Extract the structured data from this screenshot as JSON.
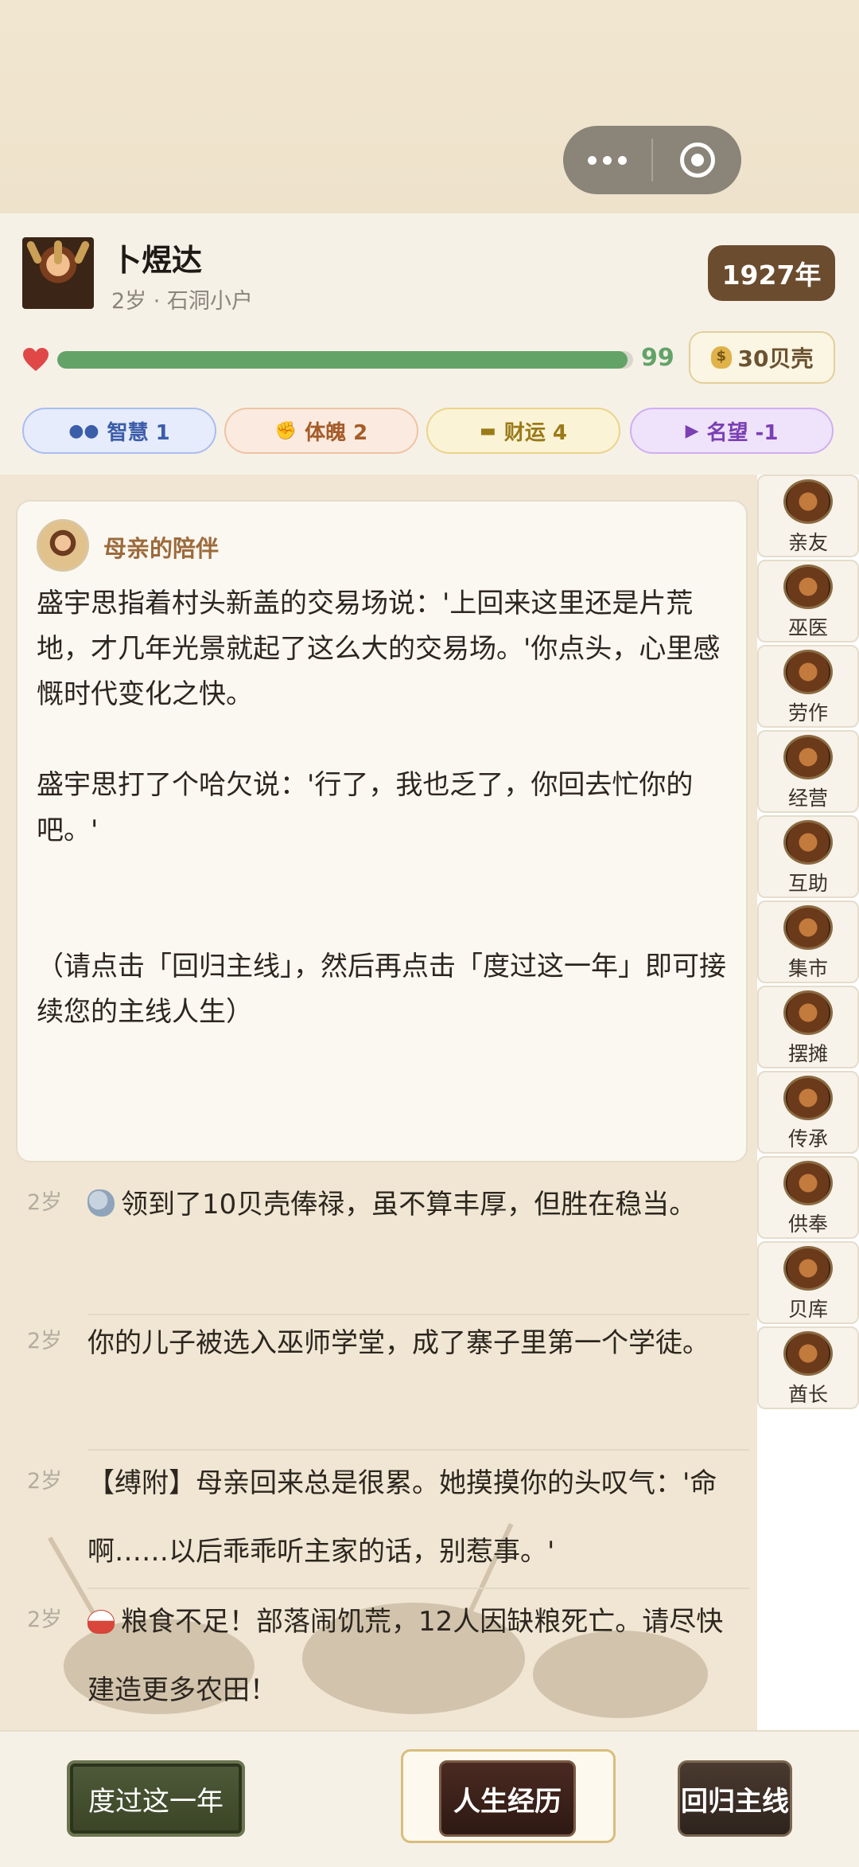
{
  "player": {
    "name": "卜煜达",
    "subinfo": "2岁 · 石洞小户",
    "year": "1927年",
    "hp_value": "99",
    "hp_fraction": 0.99,
    "shells": "30贝壳"
  },
  "stats": [
    {
      "icon": "brain-icon",
      "glyph": "●●",
      "label": "智慧 1"
    },
    {
      "icon": "muscle-icon",
      "glyph": "✊",
      "label": "体魄 2"
    },
    {
      "icon": "gold-ingot-icon",
      "glyph": "▬",
      "label": "财运 4"
    },
    {
      "icon": "megaphone-icon",
      "glyph": "▶",
      "label": "名望 -1"
    }
  ],
  "story": {
    "title": "母亲的陪伴",
    "body": "盛宇思指着村头新盖的交易场说：'上回来这里还是片荒地，才几年光景就起了这么大的交易场。'你点头，心里感慨时代变化之快。\n\n盛宇思打了个哈欠说：'行了，我也乏了，你回去忙你的吧。'\n\n\n（请点击「回归主线」，然后再点击「度过这一年」即可接续您的主线人生）"
  },
  "log": [
    {
      "age": "2岁",
      "icon": "shell",
      "text": "领到了10贝壳俸禄，虽不算丰厚，但胜在稳当。"
    },
    {
      "age": "2岁",
      "icon": "",
      "text": "你的儿子被选入巫师学堂，成了寨子里第一个学徒。"
    },
    {
      "age": "2岁",
      "icon": "",
      "text": "【缚附】母亲回来总是很累。她摸摸你的头叹气：'命啊……以后乖乖听主家的话，别惹事。'"
    },
    {
      "age": "2岁",
      "icon": "rice",
      "text": "粮食不足！部落闹饥荒，12人因缺粮死亡。请尽快建造更多农田！"
    }
  ],
  "sidebar": [
    "亲友",
    "巫医",
    "劳作",
    "经营",
    "互助",
    "集市",
    "摆摊",
    "传承",
    "供奉",
    "贝库",
    "酋长"
  ],
  "buttons": {
    "pass_year": "度过这一年",
    "life_history": "人生经历",
    "back_main": "回归主线"
  },
  "colors": {
    "hp_green": "#63a368",
    "year_badge": "#6b4c2e",
    "heart_red": "#e04848"
  }
}
